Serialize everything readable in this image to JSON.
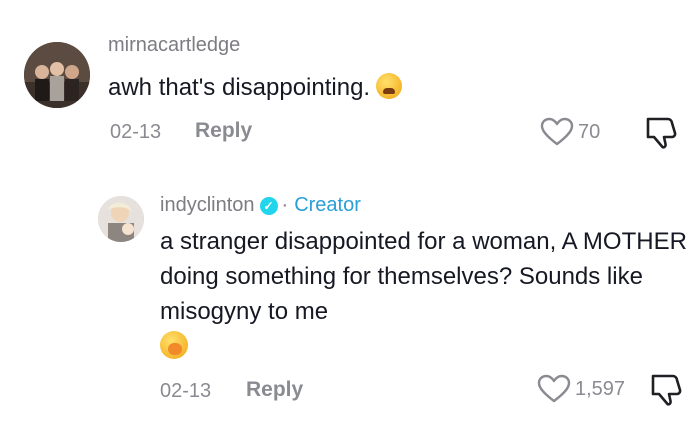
{
  "comments": [
    {
      "username": "mirnacartledge",
      "text": "awh that's disappointing.",
      "emoji": "weary-face-emoji",
      "date": "02-13",
      "reply_label": "Reply",
      "likes": "70"
    },
    {
      "username": "indyclinton",
      "separator": "·",
      "creator_label": "Creator",
      "text": "a stranger disappointed for a woman, A MOTHER doing something for themselves? Sounds like misogyny to me",
      "emoji": "yawning-face-emoji",
      "date": "02-13",
      "reply_label": "Reply",
      "likes": "1,597"
    }
  ],
  "colors": {
    "creator": "#2a9fd6",
    "muted": "#8a8b91",
    "badge": "#20d5ec"
  }
}
